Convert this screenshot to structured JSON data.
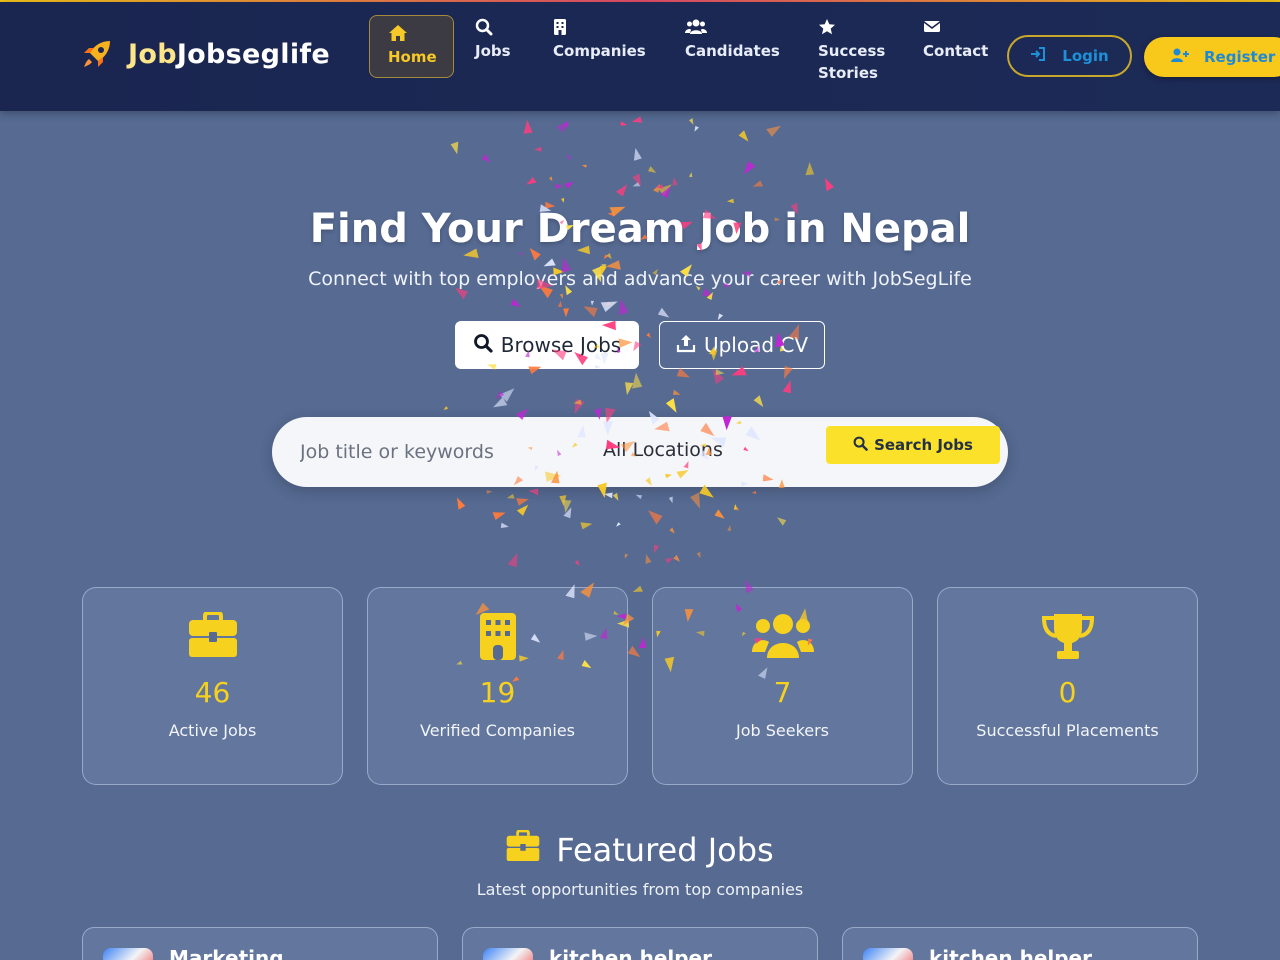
{
  "brand": {
    "part1": "Job",
    "part2": "Jobseglife",
    "icon": "rocket-icon"
  },
  "nav": {
    "items": [
      {
        "label": "Home",
        "icon": "home-icon",
        "active": true
      },
      {
        "label": "Jobs",
        "icon": "search-icon"
      },
      {
        "label": "Companies",
        "icon": "building-icon"
      },
      {
        "label": "Candidates",
        "icon": "users-icon"
      },
      {
        "label": "Success",
        "label2": "Stories",
        "icon": "star-icon"
      },
      {
        "label": "Contact",
        "icon": "envelope-icon"
      }
    ],
    "login_label": "Login",
    "register_label": "Register"
  },
  "hero": {
    "title": "Find Your Dream Job in Nepal",
    "subtitle": "Connect with top employers and advance your career with JobSegLife",
    "browse_label": "Browse Jobs",
    "upload_label": "Upload CV"
  },
  "search": {
    "placeholder": "Job title or keywords",
    "location": "All Locations",
    "button_label": "Search Jobs"
  },
  "stats": [
    {
      "value": "46",
      "label": "Active Jobs",
      "icon": "briefcase-icon"
    },
    {
      "value": "19",
      "label": "Verified Companies",
      "icon": "building-icon"
    },
    {
      "value": "7",
      "label": "Job Seekers",
      "icon": "users-icon"
    },
    {
      "value": "0",
      "label": "Successful Placements",
      "icon": "trophy-icon"
    }
  ],
  "featured": {
    "title": "Featured Jobs",
    "subtitle": "Latest opportunities from top companies",
    "jobs": [
      {
        "title": "Marketing"
      },
      {
        "title": "kitchen helper"
      },
      {
        "title": "kitchen helper"
      }
    ]
  },
  "colors": {
    "accent": "#f6c928",
    "navbar": "#1a2650",
    "background": "#566a92",
    "link": "#1e90d8"
  }
}
